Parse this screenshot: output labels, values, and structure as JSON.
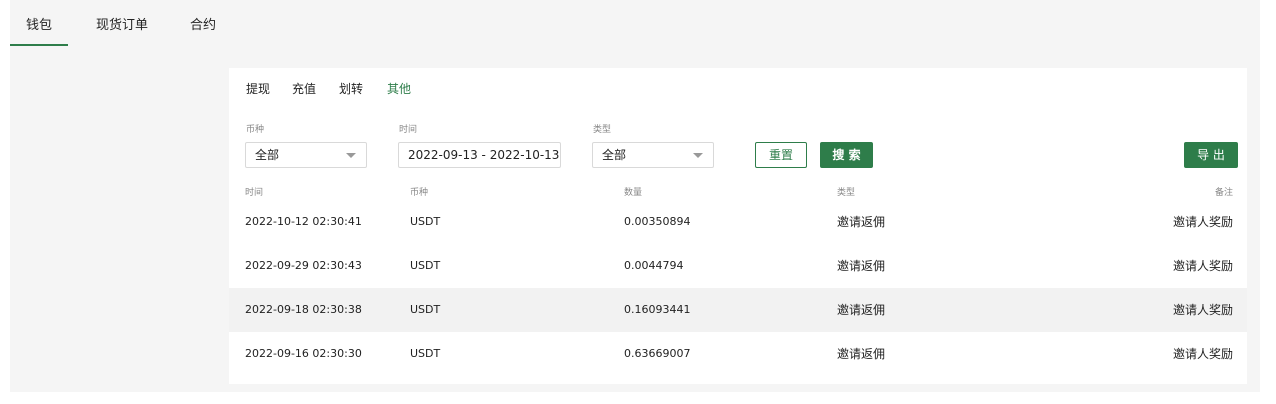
{
  "top_tabs": [
    "钱包",
    "现货订单",
    "合约"
  ],
  "sub_tabs": [
    "提现",
    "充值",
    "划转",
    "其他"
  ],
  "filters": {
    "currency_label": "币种",
    "currency_value": "全部",
    "time_label": "时间",
    "time_value": "2022-09-13 - 2022-10-13",
    "type_label": "类型",
    "type_value": "全部"
  },
  "buttons": {
    "reset": "重置",
    "search": "搜 索",
    "export": "导 出"
  },
  "table": {
    "headers": [
      "时间",
      "币种",
      "数量",
      "类型",
      "备注"
    ],
    "rows": [
      [
        "2022-10-12 02:30:41",
        "USDT",
        "0.00350894",
        "邀请返佣",
        "邀请人奖励"
      ],
      [
        "2022-09-29 02:30:43",
        "USDT",
        "0.0044794",
        "邀请返佣",
        "邀请人奖励"
      ],
      [
        "2022-09-18 02:30:38",
        "USDT",
        "0.16093441",
        "邀请返佣",
        "邀请人奖励"
      ],
      [
        "2022-09-16 02:30:30",
        "USDT",
        "0.63669007",
        "邀请返佣",
        "邀请人奖励"
      ]
    ]
  },
  "colors": {
    "accent": "#2e7d4a",
    "row_highlight": "#f2f2f2",
    "background": "#f5f5f5"
  },
  "icons": {
    "select_caret": "caret-down-icon"
  }
}
